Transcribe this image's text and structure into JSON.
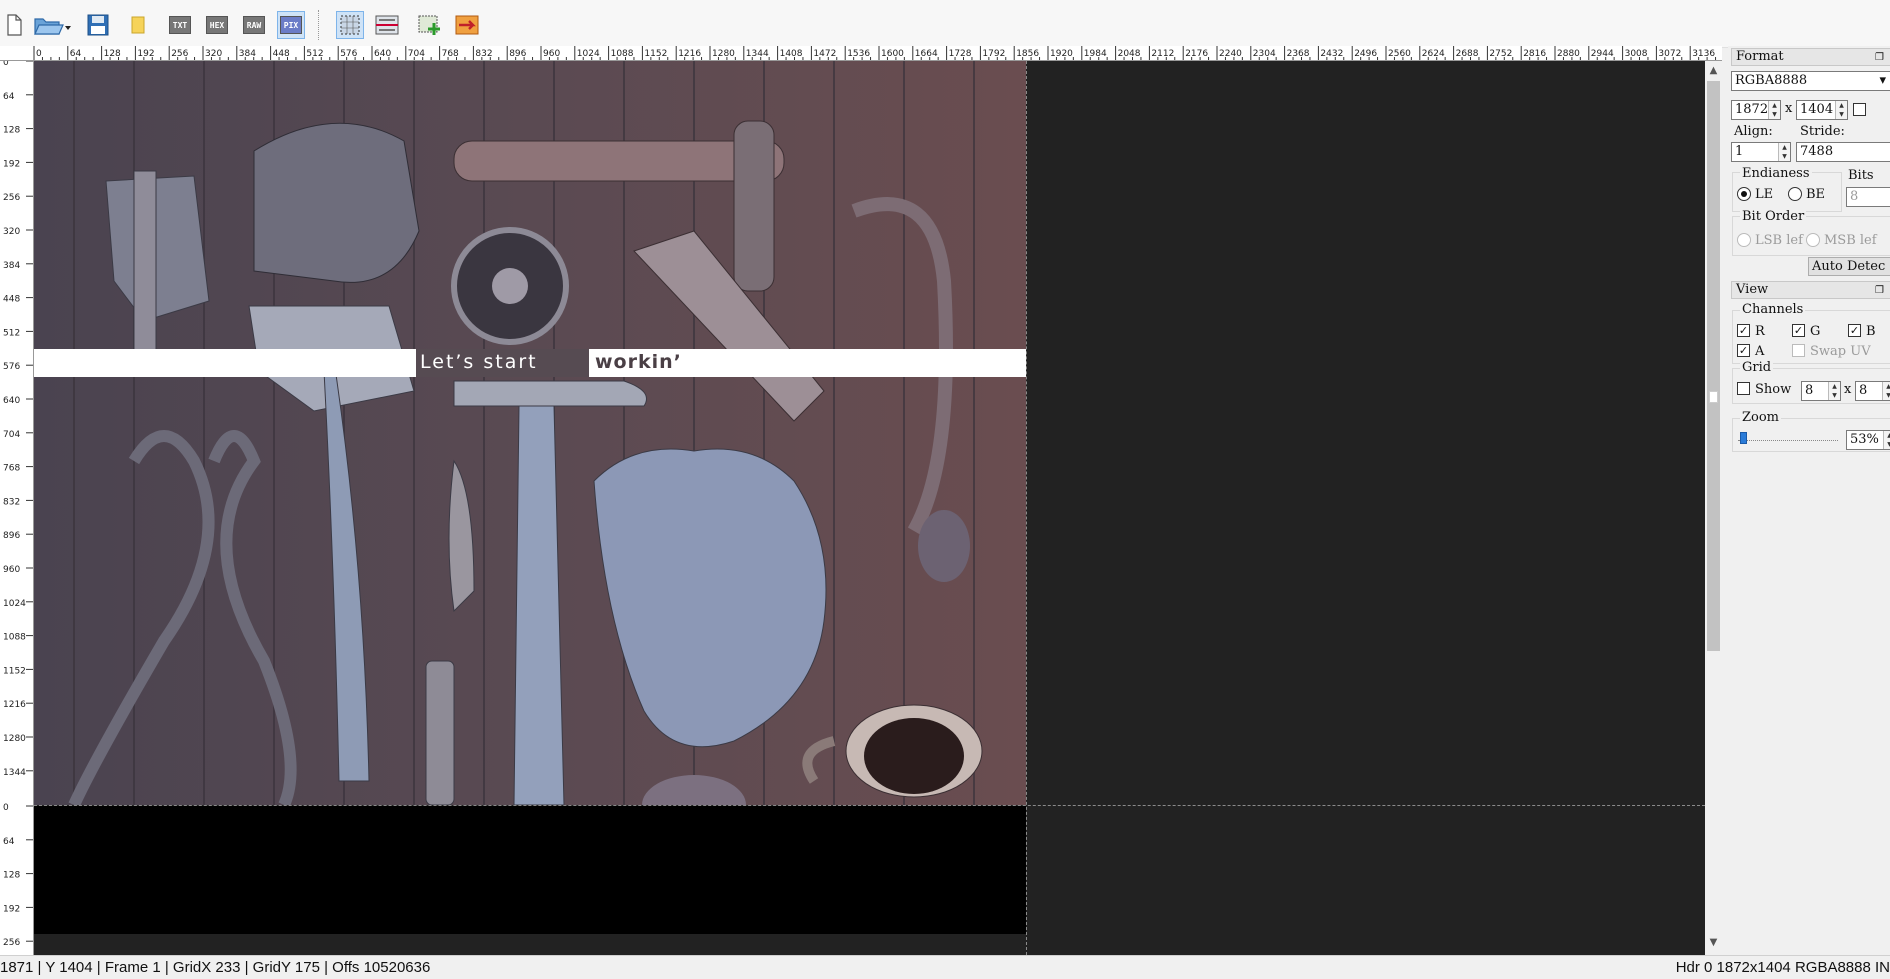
{
  "toolbar": {
    "buttons": [
      {
        "name": "new-file",
        "label": ""
      },
      {
        "name": "open-file",
        "label": ""
      },
      {
        "name": "save",
        "label": ""
      },
      {
        "name": "copy",
        "label": ""
      },
      {
        "name": "view-txt",
        "label": "TXT"
      },
      {
        "name": "view-hex",
        "label": "HEX"
      },
      {
        "name": "view-raw",
        "label": "RAW"
      },
      {
        "name": "view-pixels",
        "label": "PIX"
      },
      {
        "name": "select-region",
        "label": ""
      },
      {
        "name": "fit-view",
        "label": ""
      },
      {
        "name": "add-image",
        "label": ""
      },
      {
        "name": "export-image",
        "label": ""
      }
    ]
  },
  "ruler": {
    "h_ticks": [
      "0",
      "64",
      "128",
      "192",
      "256",
      "320",
      "384",
      "448",
      "512",
      "576",
      "640",
      "704",
      "768",
      "832",
      "896",
      "960",
      "1024",
      "1088",
      "1152",
      "1216",
      "1280",
      "1344",
      "1408",
      "1472",
      "1536",
      "1600",
      "1664",
      "1728",
      "1792",
      "1856",
      "1920",
      "1984",
      "2048",
      "2112",
      "2176",
      "2240",
      "2304",
      "2368",
      "2432",
      "2496",
      "2560",
      "2624",
      "2688",
      "2752",
      "2816",
      "2880",
      "2944",
      "3008",
      "3072",
      "3136"
    ],
    "v_ticks_frame1": [
      "0",
      "64",
      "128",
      "192",
      "256",
      "320",
      "384",
      "448",
      "512",
      "576",
      "640",
      "704",
      "768",
      "832",
      "896",
      "960",
      "1024",
      "1088",
      "1152",
      "1216",
      "1280",
      "1344"
    ],
    "v_ticks_frame2": [
      "0",
      "64",
      "128",
      "192",
      "256"
    ]
  },
  "canvas": {
    "banner_text_1": "Let’s start",
    "banner_text_2": "workin’"
  },
  "format_panel": {
    "title": "Format",
    "pixel_format": "RGBA8888",
    "width": "1872",
    "x_sep": "x",
    "height": "1404",
    "align_label": "Align:",
    "align_value": "1",
    "stride_label": "Stride:",
    "stride_value": "7488",
    "endianness_label": "Endianess",
    "le_label": "LE",
    "be_label": "BE",
    "bits_label": "Bits",
    "bits_value": "8",
    "bit_order_label": "Bit Order",
    "lsb_label": "LSB lef",
    "msb_label": "MSB lef",
    "auto_detect_label": "Auto Detec"
  },
  "view_panel": {
    "title": "View",
    "channels_label": "Channels",
    "r_label": "R",
    "g_label": "G",
    "b_label": "B",
    "a_label": "A",
    "swap_uv_label": "Swap UV",
    "grid_label": "Grid",
    "show_label": "Show",
    "grid_x": "8",
    "grid_x_sep": "x",
    "grid_y": "8",
    "zoom_label": "Zoom",
    "zoom_value": "53%"
  },
  "status": {
    "left": "1871 | Y 1404 | Frame 1 | GridX 233 | GridY 175 | Offs 10520636",
    "right": "Hdr 0  1872x1404  RGBA8888  IN"
  }
}
